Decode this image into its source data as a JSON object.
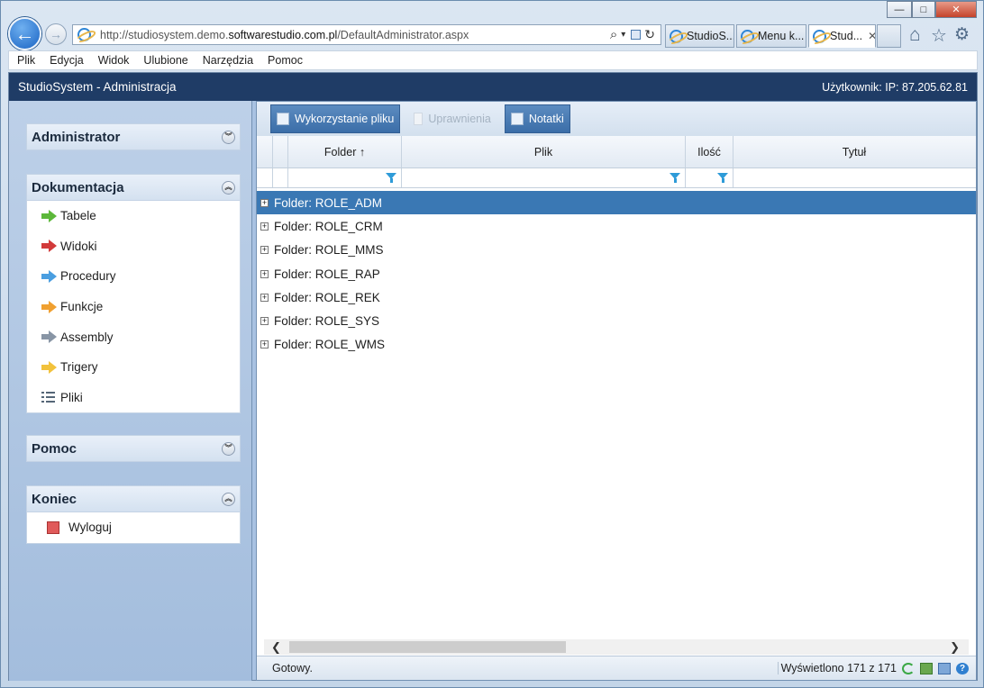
{
  "browser": {
    "url_prefix": "http://studiosystem.demo.",
    "url_domain": "softwarestudio.com.pl",
    "url_path": "/DefaultAdministrator.aspx",
    "tabs": [
      {
        "label": "StudioS...",
        "active": false
      },
      {
        "label": "Menu k...",
        "active": false
      },
      {
        "label": "Stud...",
        "active": true
      }
    ],
    "tab_close": "✕",
    "search_glyph": "⌕",
    "dropdown_glyph": "▾",
    "refresh_glyph": "↻",
    "home_glyph": "⌂",
    "star_glyph": "☆",
    "gear_glyph": "⚙",
    "minimize_glyph": "—",
    "maximize_glyph": "□",
    "close_glyph": "✕",
    "back_glyph": "←",
    "forward_glyph": "→"
  },
  "menubar": [
    "Plik",
    "Edycja",
    "Widok",
    "Ulubione",
    "Narzędzia",
    "Pomoc"
  ],
  "app": {
    "title": "StudioSystem - Administracja",
    "user_label": "Użytkownik: IP: 87.205.62.81"
  },
  "sidebar": {
    "administrator": {
      "title": "Administrator",
      "chev": "︾"
    },
    "dokumentacja": {
      "title": "Dokumentacja",
      "chev": "︽",
      "items": [
        {
          "label": "Tabele",
          "color": "#5cb83a"
        },
        {
          "label": "Widoki",
          "color": "#d23a3a"
        },
        {
          "label": "Procedury",
          "color": "#4a9ee0"
        },
        {
          "label": "Funkcje",
          "color": "#f0a030"
        },
        {
          "label": "Assembly",
          "color": "#8895a5"
        },
        {
          "label": "Trigery",
          "color": "#f2c23c"
        },
        {
          "label": "Pliki",
          "color": "#556677"
        }
      ]
    },
    "pomoc": {
      "title": "Pomoc",
      "chev": "︾"
    },
    "koniec": {
      "title": "Koniec",
      "chev": "︽",
      "items": [
        {
          "label": "Wyloguj"
        }
      ]
    }
  },
  "toolbar": {
    "wykorzystanie": "Wykorzystanie pliku",
    "uprawnienia": "Uprawnienia",
    "notatki": "Notatki"
  },
  "grid": {
    "columns": [
      "Folder ↑",
      "Plik",
      "Ilość",
      "Tytuł"
    ],
    "expander": "+",
    "rows": [
      "Folder: ROLE_ADM",
      "Folder: ROLE_CRM",
      "Folder: ROLE_MMS",
      "Folder: ROLE_RAP",
      "Folder: ROLE_REK",
      "Folder: ROLE_SYS",
      "Folder: ROLE_WMS"
    ]
  },
  "scroll": {
    "left": "❮",
    "right": "❯"
  },
  "status": {
    "left": "Gotowy.",
    "right": "Wyświetlono 171 z 171",
    "help": "?"
  }
}
